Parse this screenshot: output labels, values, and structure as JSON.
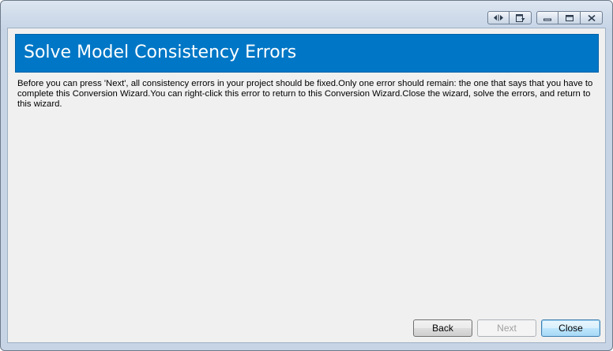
{
  "header": {
    "title": "Solve Model Consistency Errors"
  },
  "body": {
    "description": "Before you can press 'Next', all consistency errors in your project should be fixed.Only one error should remain: the one that says that you have to complete this Conversion Wizard.You can right-click this error to return to this Conversion Wizard.Close the wizard, solve the errors, and return to this wizard."
  },
  "buttons": {
    "back": "Back",
    "next": "Next",
    "close": "Close"
  },
  "window_controls": [
    {
      "icon": "float-toggle-icon"
    },
    {
      "icon": "dock-icon"
    },
    {
      "icon": "minimize-icon"
    },
    {
      "icon": "maximize-icon"
    },
    {
      "icon": "close-icon"
    }
  ],
  "colors": {
    "header_background": "#0077c6",
    "header_text": "#ffffff",
    "client_background": "#f0f0f0"
  },
  "state": {
    "next_enabled": false
  }
}
